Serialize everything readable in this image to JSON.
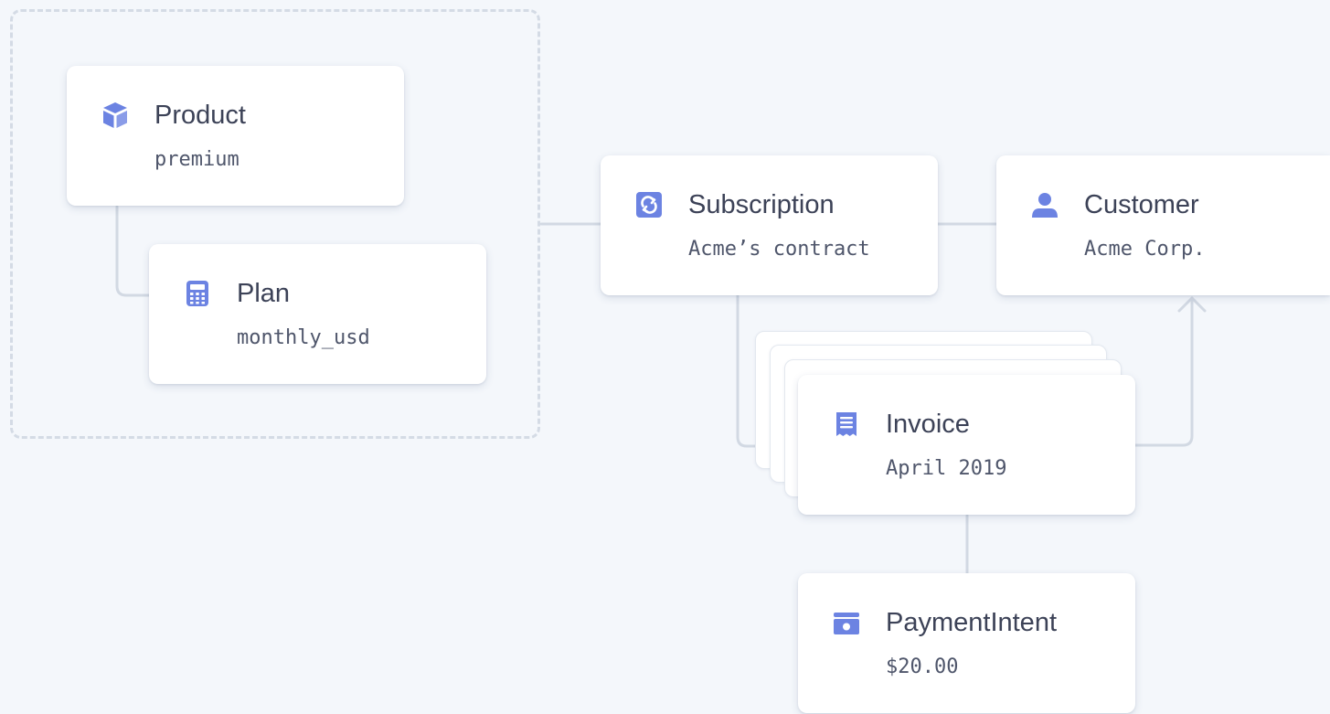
{
  "diagram": {
    "product": {
      "title": "Product",
      "value": "premium",
      "icon": "box-icon"
    },
    "plan": {
      "title": "Plan",
      "value": "monthly_usd",
      "icon": "calculator-icon"
    },
    "subscription": {
      "title": "Subscription",
      "value": "Acme’s contract",
      "icon": "refresh-icon"
    },
    "customer": {
      "title": "Customer",
      "value": "Acme Corp.",
      "icon": "person-icon"
    },
    "invoice": {
      "title": "Invoice",
      "value": "April 2019",
      "icon": "receipt-icon"
    },
    "payment_intent": {
      "title": "PaymentIntent",
      "value": "$20.00",
      "icon": "wallet-icon"
    }
  },
  "colors": {
    "background": "#f4f7fb",
    "card": "#ffffff",
    "accent": "#6c83e2",
    "connector": "#d2d9e3",
    "title_text": "#3c4257",
    "value_text": "#4f566b"
  }
}
